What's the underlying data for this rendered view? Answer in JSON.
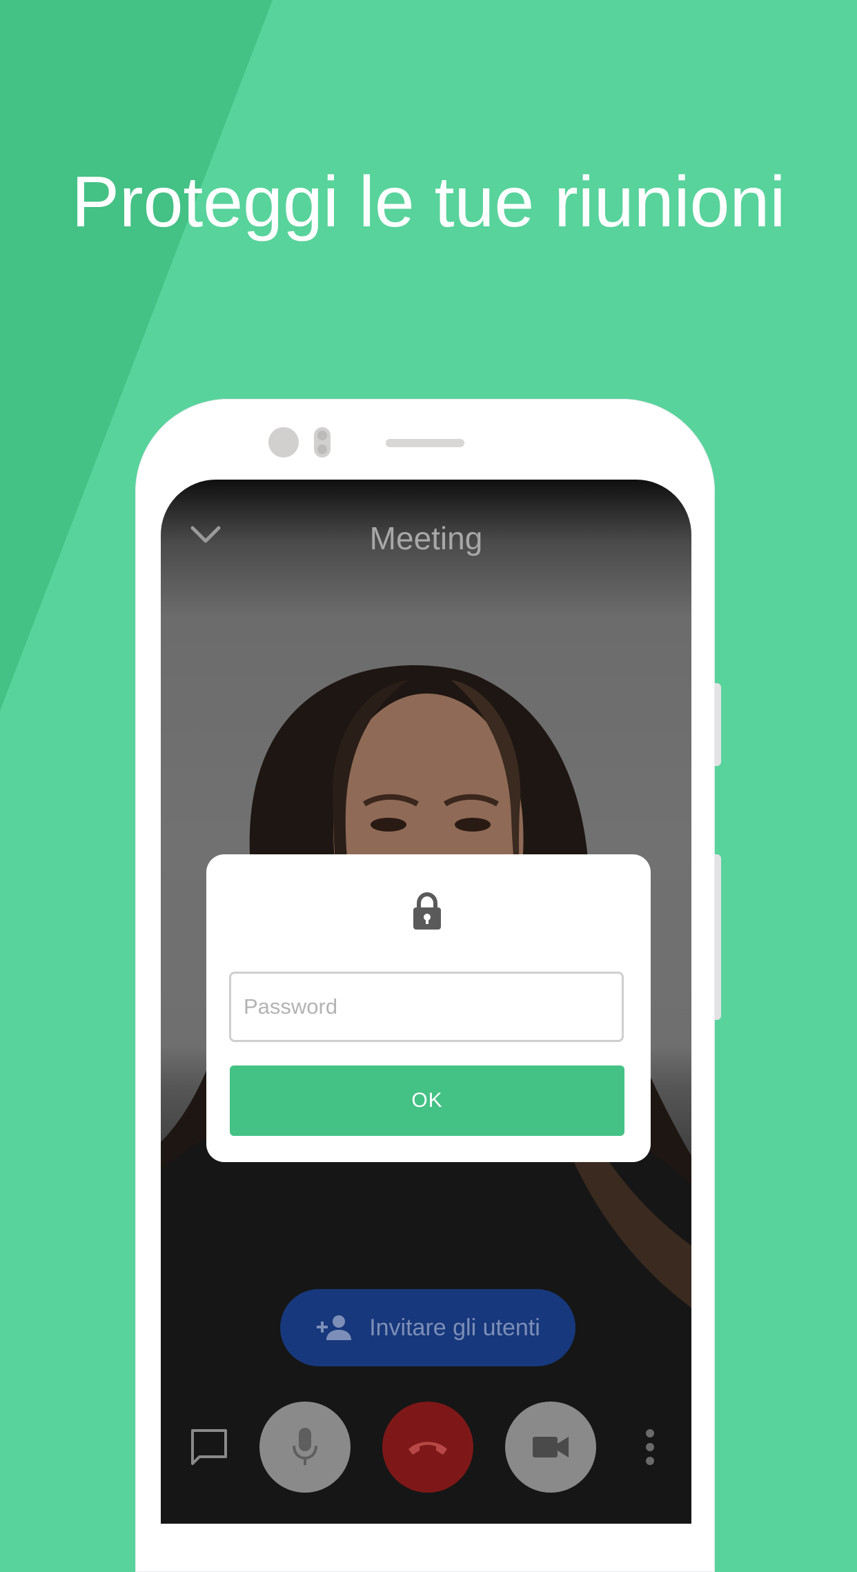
{
  "headline": "Proteggi le tue riunioni",
  "meeting": {
    "title": "Meeting"
  },
  "dialog": {
    "password_placeholder": "Password",
    "ok_label": "OK"
  },
  "invite": {
    "label": "Invitare gli utenti"
  },
  "controls": {
    "chat_icon": "chat-icon",
    "mic_icon": "mic-icon",
    "hangup_icon": "hangup-icon",
    "video_icon": "video-icon",
    "more_icon": "more-vertical-icon"
  },
  "colors": {
    "background": "#58d39b",
    "background_wedge": "#44c185",
    "accent": "#44c185",
    "invite_button": "#17387c",
    "hangup": "#7e1818"
  }
}
